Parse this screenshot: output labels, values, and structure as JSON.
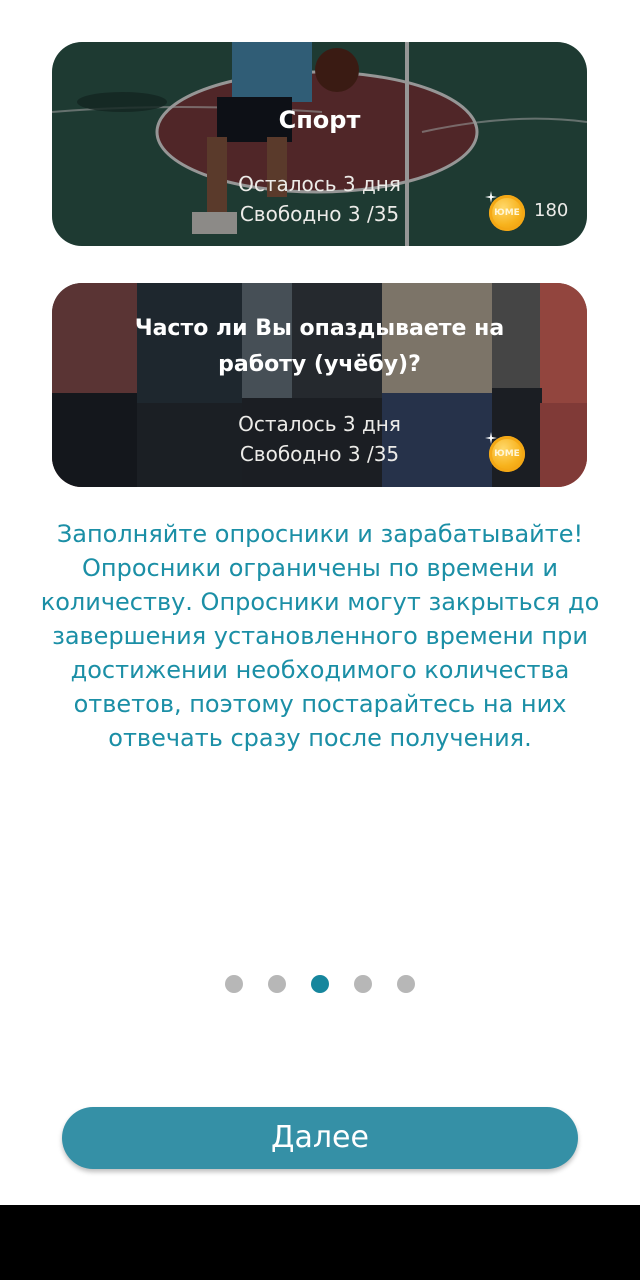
{
  "cards": [
    {
      "title": "Спорт",
      "remaining": "Осталось 3 дня",
      "free": "Свободно 3 /35",
      "coin_label": "ЮМЕ",
      "reward": "180"
    },
    {
      "title": "Часто ли Вы опаздываете на работу (учёбу)?",
      "remaining": "Осталось 3 дня",
      "free": "Свободно 3 /35",
      "coin_label": "ЮМЕ"
    }
  ],
  "info_text": "Заполняйте опросники и зарабатывайте! Опросники ограничены по времени и количеству. Опросники могут закрыться до завершения установленного времени при достижении необходимого количества ответов, поэтому постарайтесь на них отвечать сразу после получения.",
  "pagination": {
    "total": 5,
    "active_index": 2
  },
  "next_button": "Далее",
  "colors": {
    "accent": "#1b8fa6",
    "button": "#3590a6",
    "dot_active": "#16869d",
    "dot_inactive": "#b7b7b7"
  },
  "icons": {
    "coin": "coin-icon"
  }
}
